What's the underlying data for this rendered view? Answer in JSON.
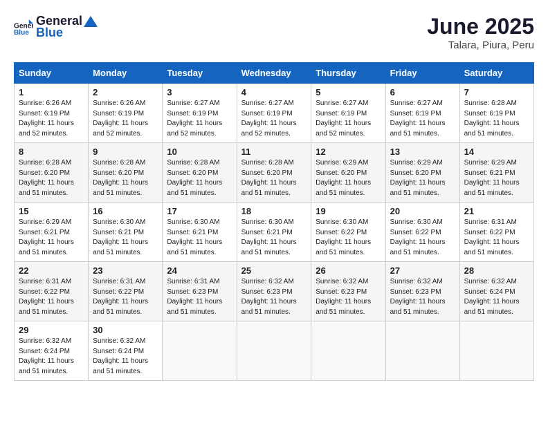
{
  "header": {
    "logo": {
      "general": "General",
      "blue": "Blue"
    },
    "title": "June 2025",
    "subtitle": "Talara, Piura, Peru"
  },
  "calendar": {
    "days_of_week": [
      "Sunday",
      "Monday",
      "Tuesday",
      "Wednesday",
      "Thursday",
      "Friday",
      "Saturday"
    ],
    "weeks": [
      [
        null,
        null,
        null,
        null,
        null,
        null,
        {
          "day": 1,
          "sunrise": "6:26 AM",
          "sunset": "6:19 PM",
          "daylight": "11 hours and 52 minutes."
        },
        {
          "day": 2,
          "sunrise": "6:26 AM",
          "sunset": "6:19 PM",
          "daylight": "11 hours and 52 minutes."
        },
        {
          "day": 3,
          "sunrise": "6:27 AM",
          "sunset": "6:19 PM",
          "daylight": "11 hours and 52 minutes."
        },
        {
          "day": 4,
          "sunrise": "6:27 AM",
          "sunset": "6:19 PM",
          "daylight": "11 hours and 52 minutes."
        },
        {
          "day": 5,
          "sunrise": "6:27 AM",
          "sunset": "6:19 PM",
          "daylight": "11 hours and 52 minutes."
        },
        {
          "day": 6,
          "sunrise": "6:27 AM",
          "sunset": "6:19 PM",
          "daylight": "11 hours and 51 minutes."
        },
        {
          "day": 7,
          "sunrise": "6:28 AM",
          "sunset": "6:19 PM",
          "daylight": "11 hours and 51 minutes."
        }
      ],
      [
        {
          "day": 8,
          "sunrise": "6:28 AM",
          "sunset": "6:20 PM",
          "daylight": "11 hours and 51 minutes."
        },
        {
          "day": 9,
          "sunrise": "6:28 AM",
          "sunset": "6:20 PM",
          "daylight": "11 hours and 51 minutes."
        },
        {
          "day": 10,
          "sunrise": "6:28 AM",
          "sunset": "6:20 PM",
          "daylight": "11 hours and 51 minutes."
        },
        {
          "day": 11,
          "sunrise": "6:28 AM",
          "sunset": "6:20 PM",
          "daylight": "11 hours and 51 minutes."
        },
        {
          "day": 12,
          "sunrise": "6:29 AM",
          "sunset": "6:20 PM",
          "daylight": "11 hours and 51 minutes."
        },
        {
          "day": 13,
          "sunrise": "6:29 AM",
          "sunset": "6:20 PM",
          "daylight": "11 hours and 51 minutes."
        },
        {
          "day": 14,
          "sunrise": "6:29 AM",
          "sunset": "6:21 PM",
          "daylight": "11 hours and 51 minutes."
        }
      ],
      [
        {
          "day": 15,
          "sunrise": "6:29 AM",
          "sunset": "6:21 PM",
          "daylight": "11 hours and 51 minutes."
        },
        {
          "day": 16,
          "sunrise": "6:30 AM",
          "sunset": "6:21 PM",
          "daylight": "11 hours and 51 minutes."
        },
        {
          "day": 17,
          "sunrise": "6:30 AM",
          "sunset": "6:21 PM",
          "daylight": "11 hours and 51 minutes."
        },
        {
          "day": 18,
          "sunrise": "6:30 AM",
          "sunset": "6:21 PM",
          "daylight": "11 hours and 51 minutes."
        },
        {
          "day": 19,
          "sunrise": "6:30 AM",
          "sunset": "6:22 PM",
          "daylight": "11 hours and 51 minutes."
        },
        {
          "day": 20,
          "sunrise": "6:30 AM",
          "sunset": "6:22 PM",
          "daylight": "11 hours and 51 minutes."
        },
        {
          "day": 21,
          "sunrise": "6:31 AM",
          "sunset": "6:22 PM",
          "daylight": "11 hours and 51 minutes."
        }
      ],
      [
        {
          "day": 22,
          "sunrise": "6:31 AM",
          "sunset": "6:22 PM",
          "daylight": "11 hours and 51 minutes."
        },
        {
          "day": 23,
          "sunrise": "6:31 AM",
          "sunset": "6:22 PM",
          "daylight": "11 hours and 51 minutes."
        },
        {
          "day": 24,
          "sunrise": "6:31 AM",
          "sunset": "6:23 PM",
          "daylight": "11 hours and 51 minutes."
        },
        {
          "day": 25,
          "sunrise": "6:32 AM",
          "sunset": "6:23 PM",
          "daylight": "11 hours and 51 minutes."
        },
        {
          "day": 26,
          "sunrise": "6:32 AM",
          "sunset": "6:23 PM",
          "daylight": "11 hours and 51 minutes."
        },
        {
          "day": 27,
          "sunrise": "6:32 AM",
          "sunset": "6:23 PM",
          "daylight": "11 hours and 51 minutes."
        },
        {
          "day": 28,
          "sunrise": "6:32 AM",
          "sunset": "6:24 PM",
          "daylight": "11 hours and 51 minutes."
        }
      ],
      [
        {
          "day": 29,
          "sunrise": "6:32 AM",
          "sunset": "6:24 PM",
          "daylight": "11 hours and 51 minutes."
        },
        {
          "day": 30,
          "sunrise": "6:32 AM",
          "sunset": "6:24 PM",
          "daylight": "11 hours and 51 minutes."
        },
        null,
        null,
        null,
        null,
        null
      ]
    ]
  }
}
